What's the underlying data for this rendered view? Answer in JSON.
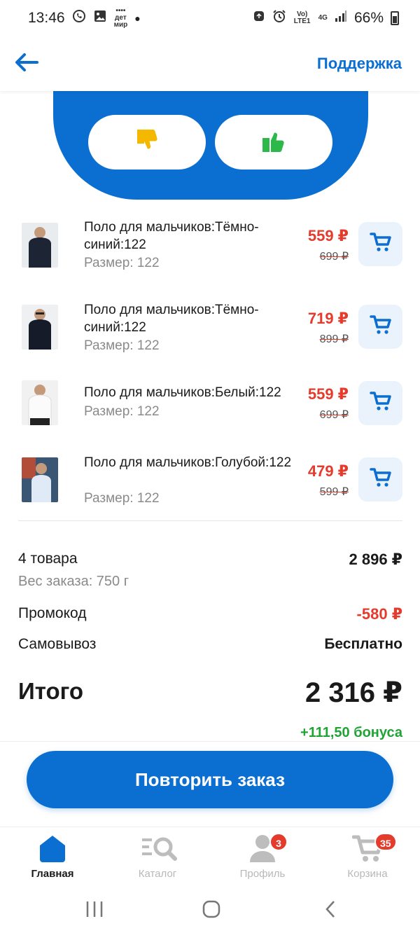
{
  "status_bar": {
    "time": "13:46",
    "network": "Vo) LTE1",
    "net_type": "4G",
    "battery": "66%"
  },
  "header": {
    "support_label": "Поддержка",
    "back_icon": "arrow-left-icon"
  },
  "feedback": {
    "dislike_icon": "thumbs-down-icon",
    "like_icon": "thumbs-up-icon"
  },
  "items": [
    {
      "title": "Поло для мальчиков:Тёмно-синий:122",
      "size": "Размер: 122",
      "price": "559 ₽",
      "old_price": "699 ₽"
    },
    {
      "title": "Поло для мальчиков:Тёмно-синий:122",
      "size": "Размер: 122",
      "price": "719 ₽",
      "old_price": "899 ₽"
    },
    {
      "title": "Поло для мальчиков:Белый:122",
      "size": "Размер: 122",
      "price": "559 ₽",
      "old_price": "699 ₽"
    },
    {
      "title": "Поло для мальчиков:Голубой:122",
      "size": "Размер: 122",
      "price": "479 ₽",
      "old_price": "599 ₽"
    }
  ],
  "summary": {
    "count_label": "4 товара",
    "count_value": "2 896 ₽",
    "weight": "Вес заказа: 750 г",
    "promo_label": "Промокод",
    "promo_value": "-580 ₽",
    "pickup_label": "Самовывоз",
    "pickup_value": "Бесплатно",
    "total_label": "Итого",
    "total_value": "2 316 ₽",
    "bonus": "+111,50 бонуса"
  },
  "repeat_button": "Повторить заказ",
  "nav": {
    "home": "Главная",
    "catalog": "Каталог",
    "profile": "Профиль",
    "profile_badge": "3",
    "cart": "Корзина",
    "cart_badge": "35"
  },
  "colors": {
    "brand_blue": "#0b6fd1",
    "price_red": "#e53b2c",
    "bonus_green": "#21a336",
    "dislike_yellow": "#f5b800",
    "like_green": "#2db84a"
  }
}
